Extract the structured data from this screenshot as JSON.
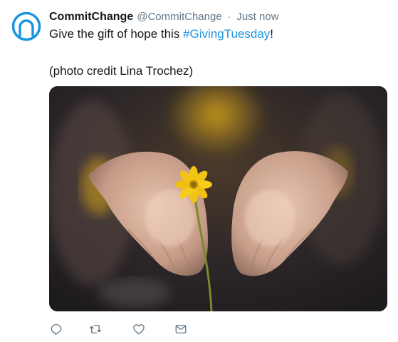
{
  "author": {
    "name": "CommitChange",
    "handle": "@CommitChange",
    "separator": "·",
    "time": "Just now",
    "brand_color": "#1b95e0"
  },
  "tweet": {
    "text_before": "Give the gift of hope this ",
    "hashtag": "#GivingTuesday",
    "text_after": "!",
    "credit": "(photo credit Lina Trochez)"
  },
  "media": {
    "type": "photo",
    "subject": "open cupped hands holding a small yellow flower"
  },
  "actions": [
    {
      "icon": "reply-icon"
    },
    {
      "icon": "retweet-icon"
    },
    {
      "icon": "like-icon"
    },
    {
      "icon": "direct-message-icon"
    }
  ]
}
